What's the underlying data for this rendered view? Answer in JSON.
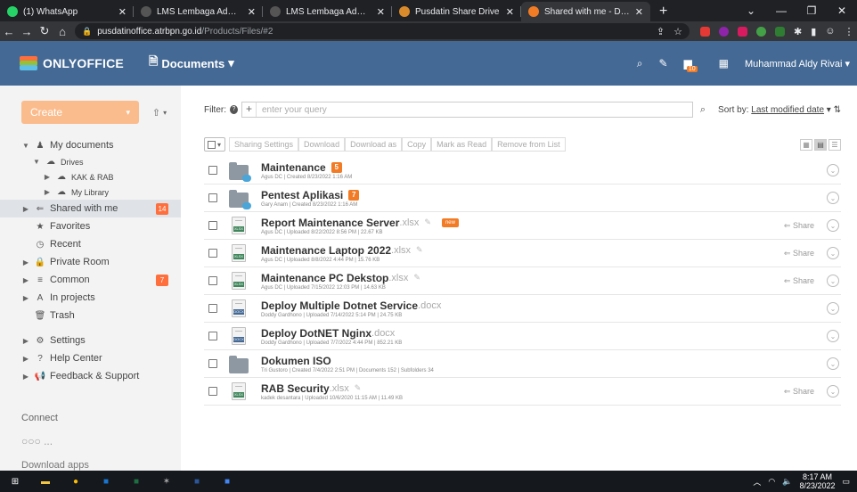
{
  "browser": {
    "tabs": [
      {
        "label": "(1) WhatsApp",
        "icon": "whatsapp-icon",
        "color": "#25d366",
        "active": false
      },
      {
        "label": "LMS Lembaga Administrasi N",
        "icon": "lms-icon",
        "color": "#555555",
        "active": false
      },
      {
        "label": "LMS Lembaga Administrasi N",
        "icon": "lms-icon",
        "color": "#555555",
        "active": false
      },
      {
        "label": "Pusdatin Share Drive",
        "icon": "drive-icon",
        "color": "#d98b2b",
        "active": false
      },
      {
        "label": "Shared with me - Document",
        "icon": "onlyoffice-icon",
        "color": "#f27b25",
        "active": true
      }
    ],
    "new_tab": "+",
    "url_host": "pusdatinoffice.atrbpn.go.id",
    "url_path": "/Products/Files/#2"
  },
  "app": {
    "logo_text": "ONLYOFFICE",
    "module": "Documents",
    "user": "Muhammad Aldy Rivai",
    "notif_badge": "10"
  },
  "sidebar": {
    "create_label": "Create",
    "tree": [
      {
        "label": "My documents",
        "icon": "user-icon",
        "arrow": "▼",
        "indent": 0,
        "small": false
      },
      {
        "label": "Drives",
        "icon": "cloud-icon",
        "arrow": "▼",
        "indent": 1,
        "small": true
      },
      {
        "label": "KAK & RAB",
        "icon": "cloud-icon",
        "arrow": "▶",
        "indent": 2,
        "small": true
      },
      {
        "label": "My Library",
        "icon": "cloud-icon",
        "arrow": "▶",
        "indent": 2,
        "small": true
      },
      {
        "label": "Shared with me",
        "icon": "share-icon",
        "arrow": "▶",
        "indent": 0,
        "small": false,
        "active": true,
        "count": "14"
      },
      {
        "label": "Favorites",
        "icon": "star-icon",
        "arrow": "",
        "indent": 0,
        "small": false
      },
      {
        "label": "Recent",
        "icon": "clock-icon",
        "arrow": "",
        "indent": 0,
        "small": false
      },
      {
        "label": "Private Room",
        "icon": "lock-icon",
        "arrow": "▶",
        "indent": 0,
        "small": false
      },
      {
        "label": "Common",
        "icon": "common-icon",
        "arrow": "▶",
        "indent": 0,
        "small": false,
        "count": "7"
      },
      {
        "label": "In projects",
        "icon": "projects-icon",
        "arrow": "▶",
        "indent": 0,
        "small": false
      },
      {
        "label": "Trash",
        "icon": "trash-icon",
        "arrow": "",
        "indent": 0,
        "small": false
      },
      {
        "label": "",
        "spacer": true
      },
      {
        "label": "Settings",
        "icon": "gear-icon",
        "arrow": "▶",
        "indent": 0,
        "small": false
      },
      {
        "label": "Help Center",
        "icon": "help-icon",
        "arrow": "▶",
        "indent": 0,
        "small": false
      },
      {
        "label": "Feedback & Support",
        "icon": "megaphone-icon",
        "arrow": "▶",
        "indent": 0,
        "small": false
      }
    ],
    "connect": "Connect",
    "more": "...",
    "download_apps": "Download apps"
  },
  "filter": {
    "label": "Filter:",
    "plus": "+",
    "placeholder": "enter your query",
    "sort_label": "Sort by:",
    "sort_value": "Last modified date"
  },
  "toolbar": {
    "buttons": [
      "Sharing Settings",
      "Download",
      "Download as",
      "Copy",
      "Mark as Read",
      "Remove from List"
    ]
  },
  "files": [
    {
      "type": "folder",
      "name": "Maintenance",
      "ext": "",
      "count": "5",
      "meta": "Agus DC | Created 8/23/2022 1:16 AM",
      "share": false,
      "new": false
    },
    {
      "type": "folder",
      "name": "Pentest Aplikasi",
      "ext": "",
      "count": "7",
      "meta": "Gary Anam | Created 8/23/2022 1:16 AM",
      "share": false,
      "new": false
    },
    {
      "type": "sheet",
      "name": "Report Maintenance Server",
      "ext": ".xlsx",
      "count": "",
      "meta": "Agus DC | Uploaded 8/22/2022 8:56 PM | 22.67 KB",
      "share": true,
      "new": true,
      "edit": true
    },
    {
      "type": "sheet",
      "name": "Maintenance Laptop 2022",
      "ext": ".xlsx",
      "count": "",
      "meta": "Agus DC | Uploaded 8/8/2022 4:44 PM | 15.76 KB",
      "share": true,
      "new": false,
      "edit": true
    },
    {
      "type": "sheet",
      "name": "Maintenance PC Dekstop",
      "ext": ".xlsx",
      "count": "",
      "meta": "Agus DC | Uploaded 7/15/2022 12:03 PM | 14.63 KB",
      "share": true,
      "new": false,
      "edit": true
    },
    {
      "type": "doc",
      "name": "Deploy Multiple Dotnet Service",
      "ext": ".docx",
      "count": "",
      "meta": "Doddy Gardhono | Uploaded 7/14/2022 5:14 PM | 24.75 KB",
      "share": false,
      "new": false
    },
    {
      "type": "doc",
      "name": "Deploy DotNET Nginx",
      "ext": ".docx",
      "count": "",
      "meta": "Doddy Gardhono | Uploaded 7/7/2022 4:44 PM | 852.21 KB",
      "share": false,
      "new": false
    },
    {
      "type": "folder-plain",
      "name": "Dokumen ISO",
      "ext": "",
      "count": "",
      "meta": "Tri Gustoro | Created 7/4/2022 2:51 PM | Documents 152 | Subfolders 34",
      "share": false,
      "new": false
    },
    {
      "type": "sheet",
      "name": "RAB Security",
      "ext": ".xlsx",
      "count": "",
      "meta": "kadek desantara | Uploaded 10/6/2020 11:15 AM | 11.49 KB",
      "share": true,
      "new": false,
      "edit": true
    }
  ],
  "labels": {
    "share": "Share",
    "new": "new"
  },
  "taskbar": {
    "time": "8:17 AM",
    "date": "8/23/2022"
  },
  "colors": {
    "header": "#446995",
    "accent": "#f27b25",
    "create": "#fbbc8d"
  }
}
